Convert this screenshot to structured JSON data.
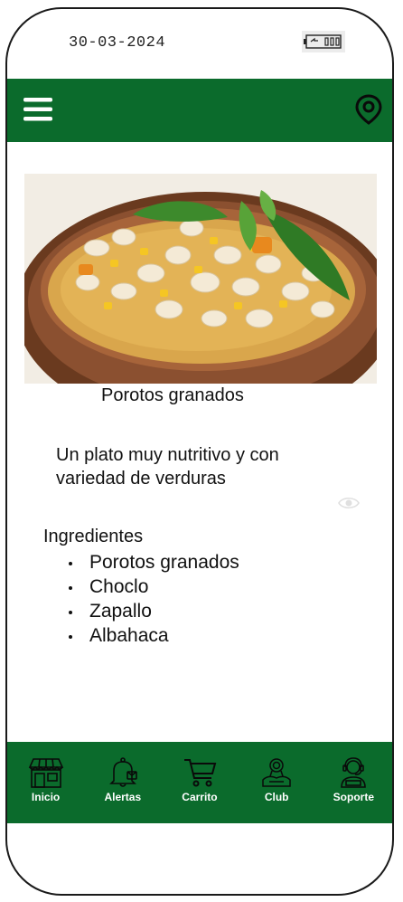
{
  "status": {
    "date": "30-03-2024"
  },
  "header": {
    "menu_icon": "hamburger-menu-icon",
    "location_icon": "map-pin-icon",
    "color": "#0b6b2c"
  },
  "dish": {
    "name": "Porotos granados",
    "description": "Un plato muy nutritivo y con variedad de verduras",
    "ingredients_title": "Ingredientes",
    "ingredients": [
      "Porotos granados",
      "Choclo",
      "Zapallo",
      "Albahaca"
    ]
  },
  "nav": {
    "items": [
      {
        "label": "Inicio",
        "icon": "store-icon"
      },
      {
        "label": "Alertas",
        "icon": "bell-icon"
      },
      {
        "label": "Carrito",
        "icon": "cart-icon"
      },
      {
        "label": "Club",
        "icon": "club-badge-icon"
      },
      {
        "label": "Soporte",
        "icon": "support-agent-icon"
      }
    ]
  }
}
